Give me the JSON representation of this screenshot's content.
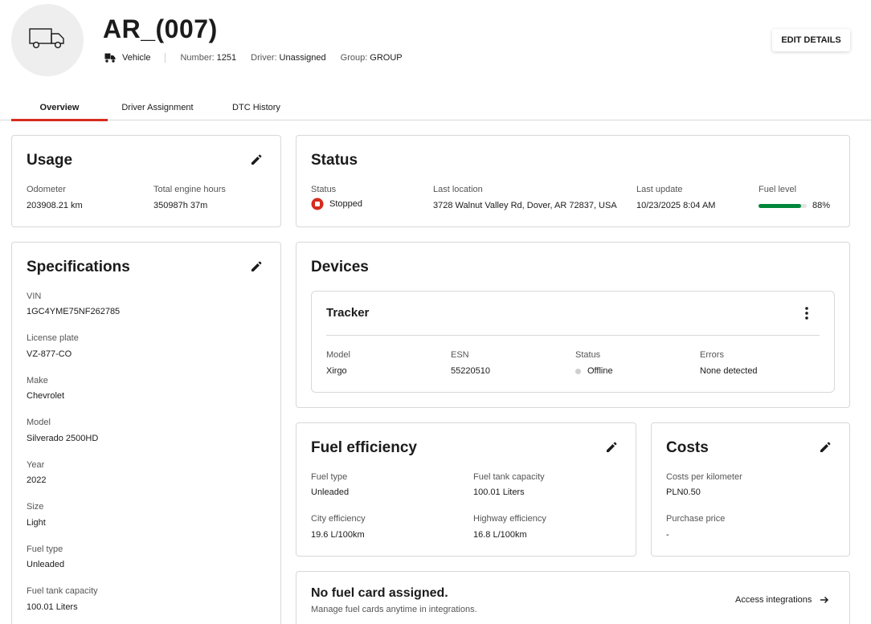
{
  "header": {
    "title": "AR_(007)",
    "type_label": "Vehicle",
    "number_label": "Number:",
    "number_value": "1251",
    "driver_label": "Driver:",
    "driver_value": "Unassigned",
    "group_label": "Group:",
    "group_value": "GROUP",
    "edit_button": "EDIT DETAILS"
  },
  "tabs": [
    {
      "label": "Overview",
      "active": true
    },
    {
      "label": "Driver Assignment",
      "active": false
    },
    {
      "label": "DTC History",
      "active": false
    }
  ],
  "usage": {
    "title": "Usage",
    "odometer_label": "Odometer",
    "odometer_value": "203908.21 km",
    "engine_hours_label": "Total engine hours",
    "engine_hours_value": "350987h 37m"
  },
  "status": {
    "title": "Status",
    "status_label": "Status",
    "status_value": "Stopped",
    "location_label": "Last location",
    "location_value": "3728 Walnut Valley Rd, Dover, AR 72837, USA",
    "update_label": "Last update",
    "update_value": "10/23/2025 8:04 AM",
    "fuel_label": "Fuel level",
    "fuel_value": "88%",
    "fuel_fraction": 0.88,
    "fuel_color": "#00873a",
    "stopped_color": "#d52b1e"
  },
  "specs": {
    "title": "Specifications",
    "items": [
      {
        "label": "VIN",
        "value": "1GC4YME75NF262785"
      },
      {
        "label": "License plate",
        "value": "VZ-877-CO"
      },
      {
        "label": "Make",
        "value": "Chevrolet"
      },
      {
        "label": "Model",
        "value": "Silverado 2500HD"
      },
      {
        "label": "Year",
        "value": "2022"
      },
      {
        "label": "Size",
        "value": "Light"
      },
      {
        "label": "Fuel type",
        "value": "Unleaded"
      },
      {
        "label": "Fuel tank capacity",
        "value": "100.01 Liters"
      }
    ]
  },
  "devices": {
    "title": "Devices",
    "tracker_title": "Tracker",
    "model_label": "Model",
    "model_value": "Xirgo",
    "esn_label": "ESN",
    "esn_value": "55220510",
    "status_label": "Status",
    "status_value": "Offline",
    "errors_label": "Errors",
    "errors_value": "None detected"
  },
  "fuel_efficiency": {
    "title": "Fuel efficiency",
    "fuel_type_label": "Fuel type",
    "fuel_type_value": "Unleaded",
    "tank_label": "Fuel tank capacity",
    "tank_value": "100.01 Liters",
    "city_label": "City efficiency",
    "city_value": "19.6 L/100km",
    "highway_label": "Highway efficiency",
    "highway_value": "16.8 L/100km"
  },
  "costs": {
    "title": "Costs",
    "per_km_label": "Costs per kilometer",
    "per_km_value": "PLN0.50",
    "purchase_label": "Purchase price",
    "purchase_value": "-"
  },
  "fuel_card": {
    "title": "No fuel card assigned.",
    "subtitle": "Manage fuel cards anytime in integrations.",
    "link": "Access integrations"
  },
  "icons": [
    "truck-icon",
    "vehicle-icon",
    "edit-icon",
    "stop-icon",
    "kebab-menu-icon",
    "arrow-right-icon"
  ]
}
